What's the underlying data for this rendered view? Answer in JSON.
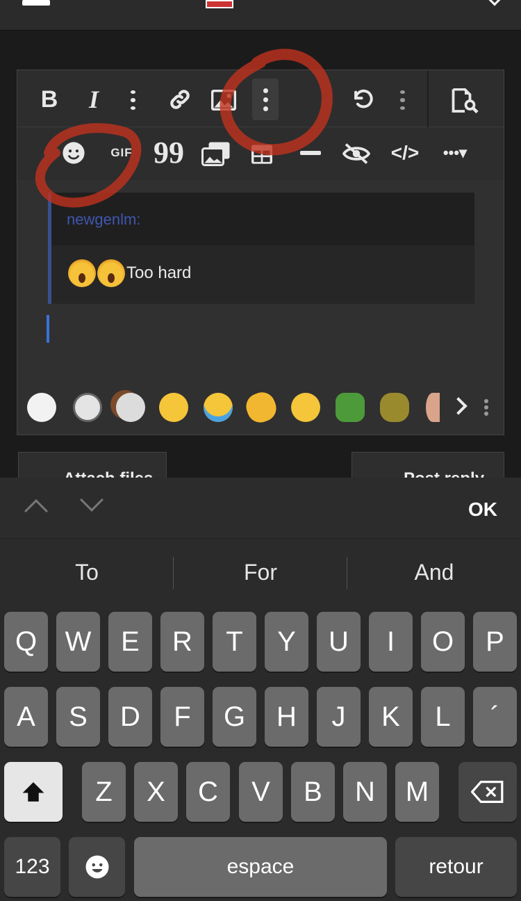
{
  "quote": {
    "author": "newgenlm:",
    "text": "Too hard"
  },
  "toolbar": {
    "row1": [
      "bold-icon",
      "italic-icon",
      "more-vertical-icon",
      "link-icon",
      "image-icon",
      "more-vertical-icon",
      "undo-icon",
      "more-vertical-icon",
      "preview-icon"
    ],
    "row2": [
      "emoji-icon",
      "gif-icon",
      "quote-icon",
      "media-icon",
      "table-icon",
      "horizontal-rule-icon",
      "spoiler-icon",
      "code-icon",
      "more-options-icon"
    ],
    "bold_label": "B",
    "italic_label": "I",
    "gif_label": "GIF",
    "quote_label": "99",
    "code_label": "</>",
    "more_label": "•••▾"
  },
  "actions": {
    "attach_files": "Attach files",
    "post_reply": "Post reply"
  },
  "accessory": {
    "ok": "OK"
  },
  "suggestions": [
    "To",
    "For",
    "And"
  ],
  "keyboard": {
    "row1": [
      "Q",
      "W",
      "E",
      "R",
      "T",
      "Y",
      "U",
      "I",
      "O",
      "P"
    ],
    "row2": [
      "A",
      "S",
      "D",
      "F",
      "G",
      "H",
      "J",
      "K",
      "L",
      "´"
    ],
    "row3": [
      "Z",
      "X",
      "C",
      "V",
      "B",
      "N",
      "M"
    ],
    "numbers": "123",
    "space": "espace",
    "return": "retour"
  },
  "annotation_color": "#c0321e"
}
